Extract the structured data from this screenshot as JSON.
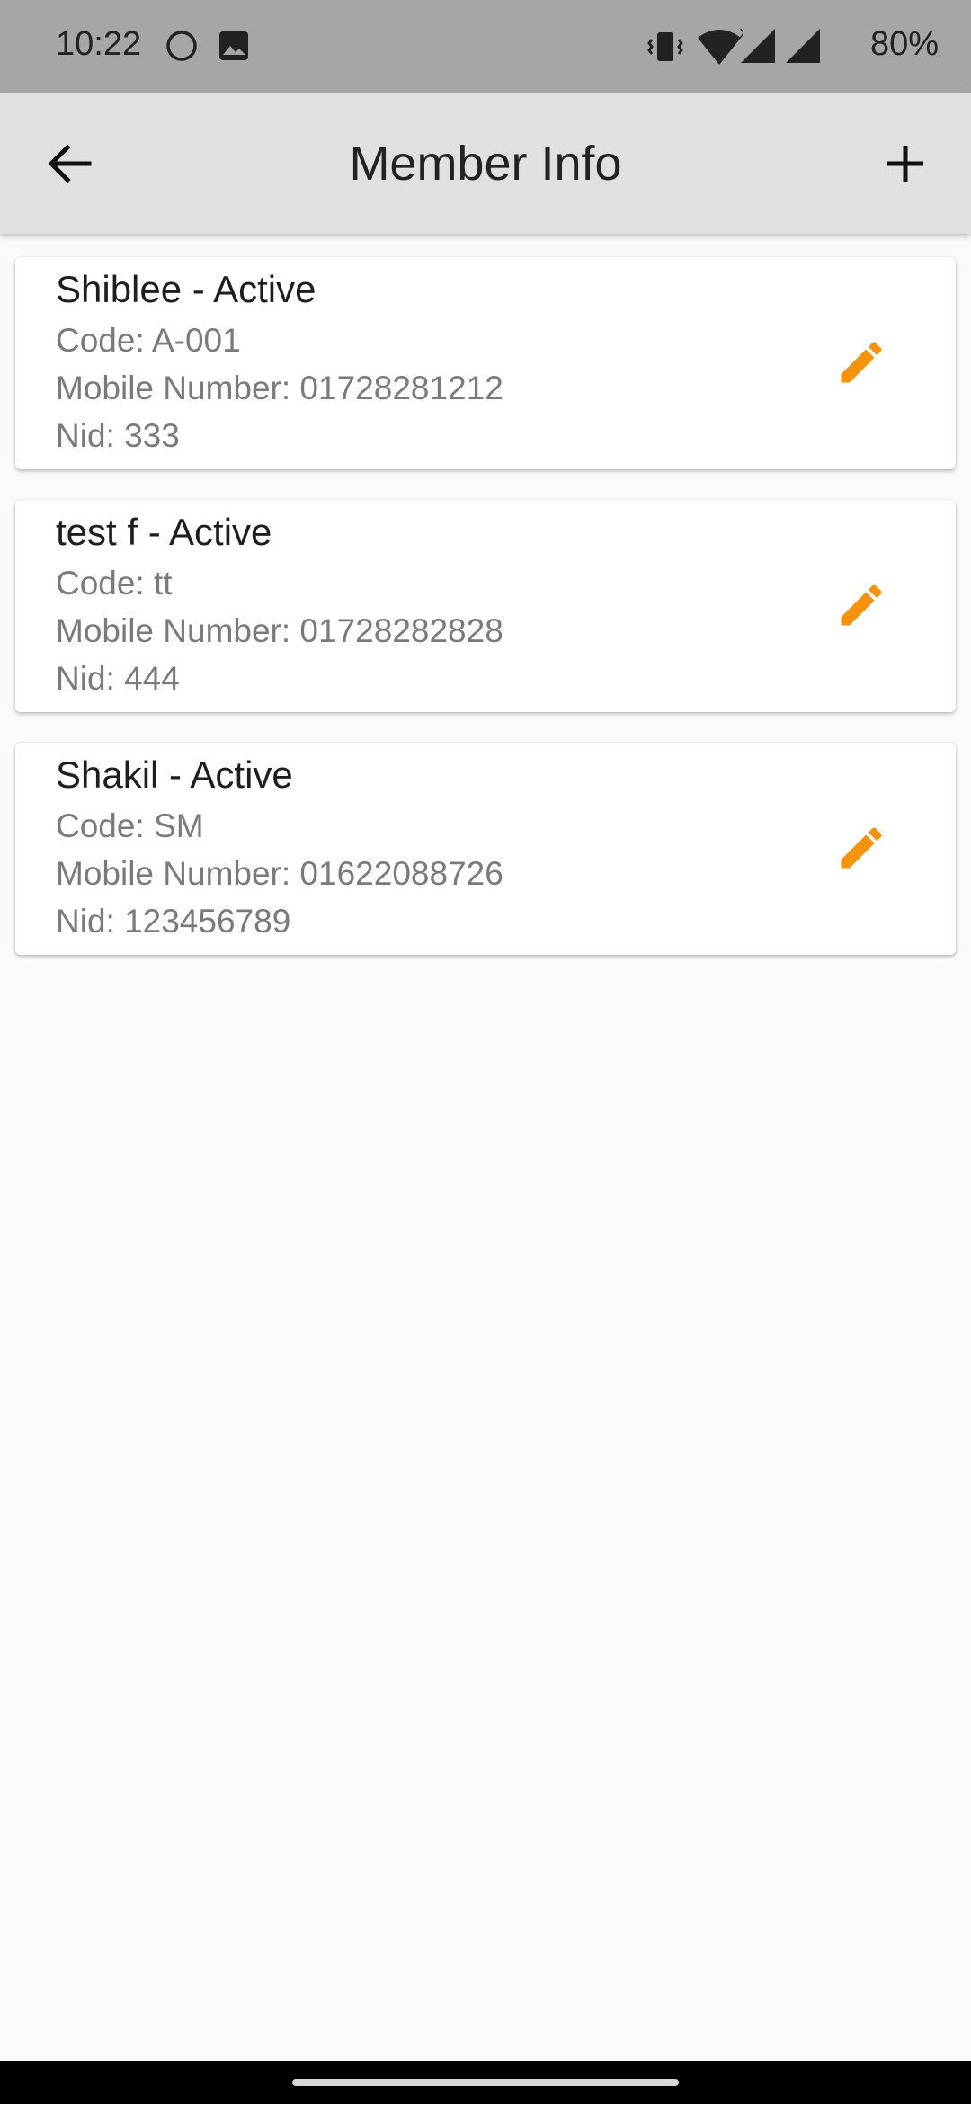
{
  "status_bar": {
    "time": "10:22",
    "battery": "80%",
    "icons": [
      "circle-icon",
      "image-icon",
      "vibrate-icon",
      "wifi-icon",
      "signal-icon",
      "signal-icon"
    ]
  },
  "app_bar": {
    "title": "Member Info",
    "back_icon": "arrow-back-icon",
    "add_icon": "plus-icon",
    "background": "#e0e0e0"
  },
  "members": [
    {
      "title": "Shiblee - Active",
      "code": "Code: A-001",
      "mobile": "Mobile Number: 01728281212",
      "nid": "Nid: 333"
    },
    {
      "title": "test f - Active",
      "code": "Code: tt",
      "mobile": "Mobile Number: 01728282828",
      "nid": "Nid: 444"
    },
    {
      "title": "Shakil - Active",
      "code": "Code: SM",
      "mobile": "Mobile Number: 01622088726",
      "nid": "Nid: 123456789"
    }
  ],
  "colors": {
    "accent": "#f5930c",
    "status_bar": "#a6a6a6",
    "background": "#fafafa"
  }
}
